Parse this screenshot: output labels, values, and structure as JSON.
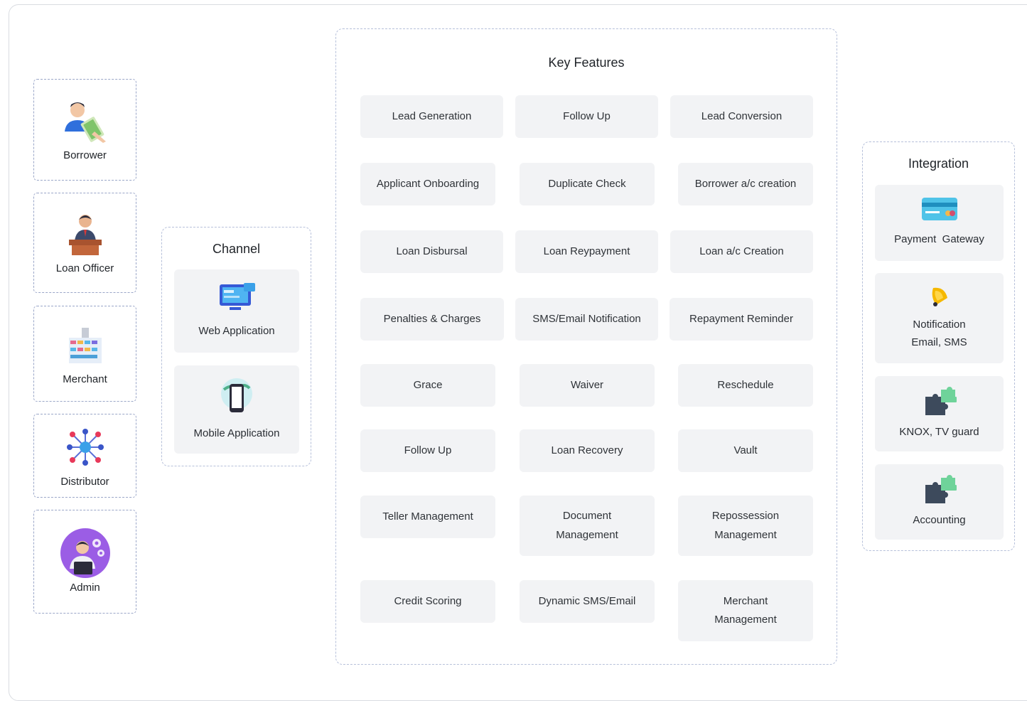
{
  "actors": [
    {
      "label": "Borrower",
      "icon": "borrower-icon"
    },
    {
      "label": "Loan Officer",
      "icon": "loan-officer-icon"
    },
    {
      "label": "Merchant",
      "icon": "merchant-shop-icon"
    },
    {
      "label": "Distributor",
      "icon": "distributor-network-icon"
    },
    {
      "label": "Admin",
      "icon": "admin-icon"
    }
  ],
  "channel": {
    "title": "Channel",
    "items": [
      {
        "label": "Web Application",
        "icon": "web-application-icon"
      },
      {
        "label": "Mobile Application",
        "icon": "mobile-application-icon"
      }
    ]
  },
  "key_features": {
    "title": "Key Features",
    "items": [
      "Lead Generation",
      "Follow Up",
      "Lead Conversion",
      "Applicant Onboarding",
      "Duplicate Check",
      "Borrower a/c creation",
      "Loan Disbursal",
      "Loan Reypayment",
      "Loan a/c Creation",
      "Penalties & Charges",
      "SMS/Email Notification",
      "Repayment Reminder",
      "Grace",
      "Waiver",
      "Reschedule",
      "Follow Up",
      "Loan Recovery",
      "Vault",
      "Teller Management",
      "Document\nManagement",
      "Repossession\nManagement",
      "Credit Scoring",
      "Dynamic SMS/Email",
      "Merchant\nManagement"
    ]
  },
  "integration": {
    "title": "Integration",
    "items": [
      {
        "label": "Payment  Gateway",
        "icon": "credit-card-icon"
      },
      {
        "label": "Notification\nEmail, SMS",
        "icon": "bell-icon"
      },
      {
        "label": "KNOX, TV guard",
        "icon": "puzzle-icon"
      },
      {
        "label": "Accounting",
        "icon": "puzzle-icon"
      }
    ]
  }
}
